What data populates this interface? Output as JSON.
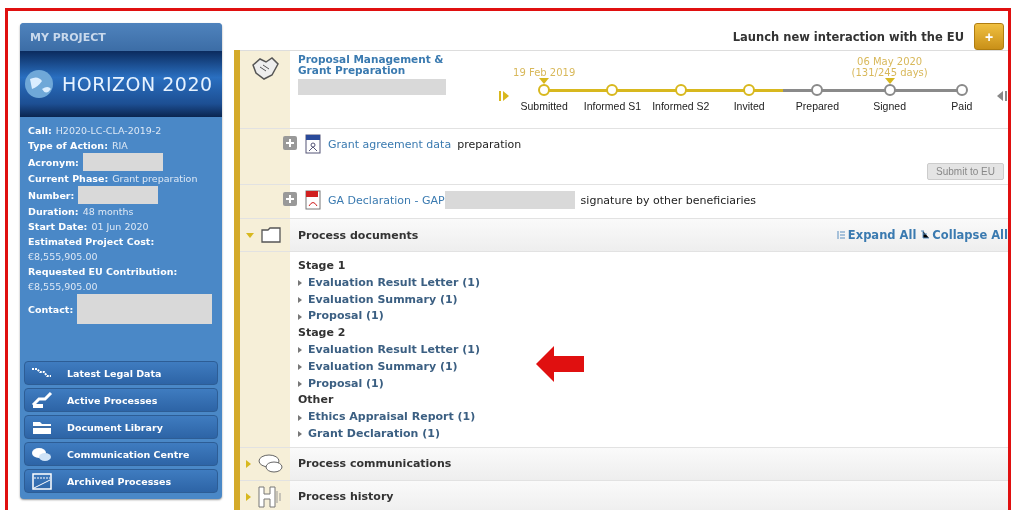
{
  "annotations": {
    "frame": true,
    "arrow": true
  },
  "project": {
    "title": "MY PROJECT",
    "programme": "HORIZON 2020",
    "fields": [
      {
        "label": "Call:",
        "value": "H2020-LC-CLA-2019-2",
        "redacted": false
      },
      {
        "label": "Type of Action:",
        "value": "RIA",
        "redacted": false
      },
      {
        "label": "Acronym:",
        "redacted": true
      },
      {
        "label": "Current Phase:",
        "value": "Grant preparation",
        "redacted": false
      },
      {
        "label": "Number:",
        "redacted": true
      },
      {
        "label": "Duration:",
        "value": "48 months",
        "redacted": false
      },
      {
        "label": "Start Date:",
        "value": "01 Jun 2020",
        "redacted": false
      },
      {
        "label": "Estimated Project Cost:",
        "value": "€8,555,905.00",
        "redacted": false
      },
      {
        "label": "Requested EU Contribution:",
        "value": "€8,555,905.00",
        "redacted": false
      },
      {
        "label": "Contact:",
        "redacted": true
      }
    ],
    "nav": [
      {
        "label": "Latest Legal Data",
        "kind": "legal"
      },
      {
        "label": "Active Processes",
        "kind": "active"
      },
      {
        "label": "Document Library",
        "kind": "library"
      },
      {
        "label": "Communication Centre",
        "kind": "communication"
      },
      {
        "label": "Archived Processes",
        "kind": "archive"
      }
    ]
  },
  "launch": {
    "label": "Launch new interaction with the EU",
    "button": "+"
  },
  "process": {
    "title": "Proposal Management & Grant Preparation",
    "redacted": true,
    "steps": [
      {
        "label": "Submitted",
        "done": true,
        "date": "19 Feb 2019"
      },
      {
        "label": "Informed S1",
        "done": true
      },
      {
        "label": "Informed S2",
        "done": true
      },
      {
        "label": "Invited",
        "done": true
      },
      {
        "label": "Prepared",
        "done": false
      },
      {
        "label": "Signed",
        "done": false,
        "date": "06 May 2020",
        "note": "(131/245 days)"
      },
      {
        "label": "Paid",
        "done": false
      }
    ]
  },
  "tasks": [
    {
      "kind": "form",
      "link": "Grant agreement data",
      "rest": "preparation",
      "redacted": false,
      "action": {
        "label": "Submit to EU",
        "disabled": true
      }
    },
    {
      "kind": "pdf",
      "link": "GA Declaration - GAP",
      "rest": "signature by other beneficiaries",
      "redacted": true
    }
  ],
  "documents": {
    "title": "Process documents",
    "expanded": true,
    "expand_all": "Expand All",
    "collapse_all": "Collapse All",
    "groups": [
      {
        "title": "Stage 1",
        "items": [
          {
            "label": "Evaluation Result Letter (1)",
            "expanded": false
          },
          {
            "label": "Evaluation Summary (1)",
            "expanded": false
          },
          {
            "label": "Proposal (1)",
            "expanded": false
          }
        ]
      },
      {
        "title": "Stage 2",
        "items": [
          {
            "label": "Evaluation Result Letter (1)",
            "expanded": false
          },
          {
            "label": "Evaluation Summary (1)",
            "expanded": false
          },
          {
            "label": "Proposal (1)",
            "expanded": false
          }
        ]
      },
      {
        "title": "Other",
        "items": [
          {
            "label": "Ethics Appraisal Report (1)",
            "expanded": false
          },
          {
            "label": "Grant Declaration (1)",
            "expanded": false
          }
        ]
      }
    ]
  },
  "sections": [
    {
      "title": "Process communications",
      "kind": "communications",
      "expanded": false
    },
    {
      "title": "Process history",
      "kind": "history",
      "expanded": false
    }
  ]
}
